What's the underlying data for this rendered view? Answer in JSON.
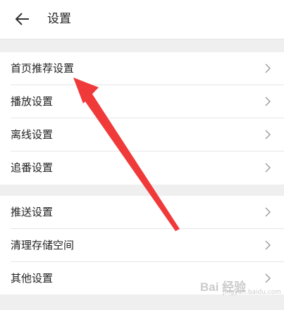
{
  "header": {
    "title": "设置",
    "back_icon": "back-arrow-icon"
  },
  "groups": [
    {
      "items": [
        {
          "label": "首页推荐设置"
        },
        {
          "label": "播放设置"
        },
        {
          "label": "离线设置"
        },
        {
          "label": "追番设置"
        }
      ]
    },
    {
      "items": [
        {
          "label": "推送设置"
        },
        {
          "label": "清理存储空间"
        },
        {
          "label": "其他设置"
        }
      ]
    }
  ],
  "annotation": {
    "arrow_color": "#f03a3a",
    "points_to": "首页推荐设置"
  },
  "watermark": {
    "logo": "Bai 经验",
    "sub": "jingyan.baidu.com"
  }
}
